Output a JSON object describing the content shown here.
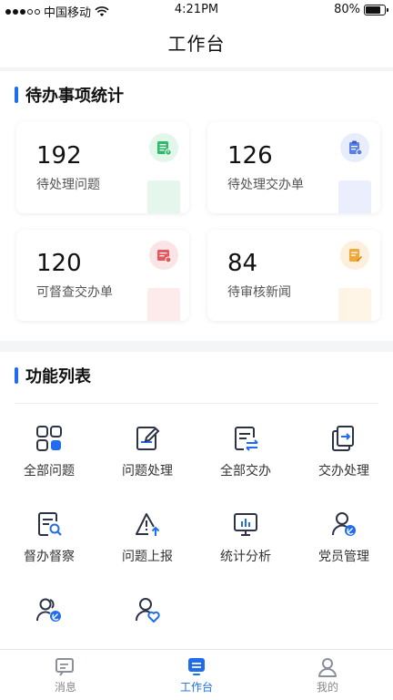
{
  "status_bar": {
    "carrier": "中国移动",
    "time": "4:21PM",
    "battery": "80%",
    "battery_level": 0.8
  },
  "nav": {
    "title": "工作台"
  },
  "stats_section": {
    "title": "待办事项统计",
    "cards": [
      {
        "value": "192",
        "label": "待处理问题",
        "icon": "checklist-icon",
        "color": "#2dbb6a",
        "bg": "#e3f6ea"
      },
      {
        "value": "126",
        "label": "待处理交办单",
        "icon": "clipboard-icon",
        "color": "#5b7fe8",
        "bg": "#e8edfb"
      },
      {
        "value": "120",
        "label": "可督查交办单",
        "icon": "inspect-doc-icon",
        "color": "#e8575c",
        "bg": "#fbe4e5"
      },
      {
        "value": "84",
        "label": "待审核新闻",
        "icon": "edit-doc-icon",
        "color": "#f1a83a",
        "bg": "#fcf0dc"
      }
    ]
  },
  "func_section": {
    "title": "功能列表",
    "items": [
      {
        "label": "全部问题",
        "icon": "grid-icon"
      },
      {
        "label": "问题处理",
        "icon": "edit-doc-icon"
      },
      {
        "label": "全部交办",
        "icon": "transfer-doc-icon"
      },
      {
        "label": "交办处理",
        "icon": "forward-doc-icon"
      },
      {
        "label": "督办督察",
        "icon": "search-doc-icon"
      },
      {
        "label": "问题上报",
        "icon": "warning-upload-icon"
      },
      {
        "label": "统计分析",
        "icon": "chart-monitor-icon"
      },
      {
        "label": "党员管理",
        "icon": "party-member-icon"
      },
      {
        "label": "",
        "icon": "party-group-icon"
      },
      {
        "label": "",
        "icon": "user-heart-icon"
      }
    ]
  },
  "tab_bar": {
    "tabs": [
      {
        "label": "消息",
        "icon": "message-icon",
        "active": false
      },
      {
        "label": "工作台",
        "icon": "workbench-icon",
        "active": true
      },
      {
        "label": "我的",
        "icon": "profile-icon",
        "active": false
      }
    ]
  },
  "colors": {
    "accent": "#1f6cf0",
    "icon_dark": "#2c3347"
  }
}
